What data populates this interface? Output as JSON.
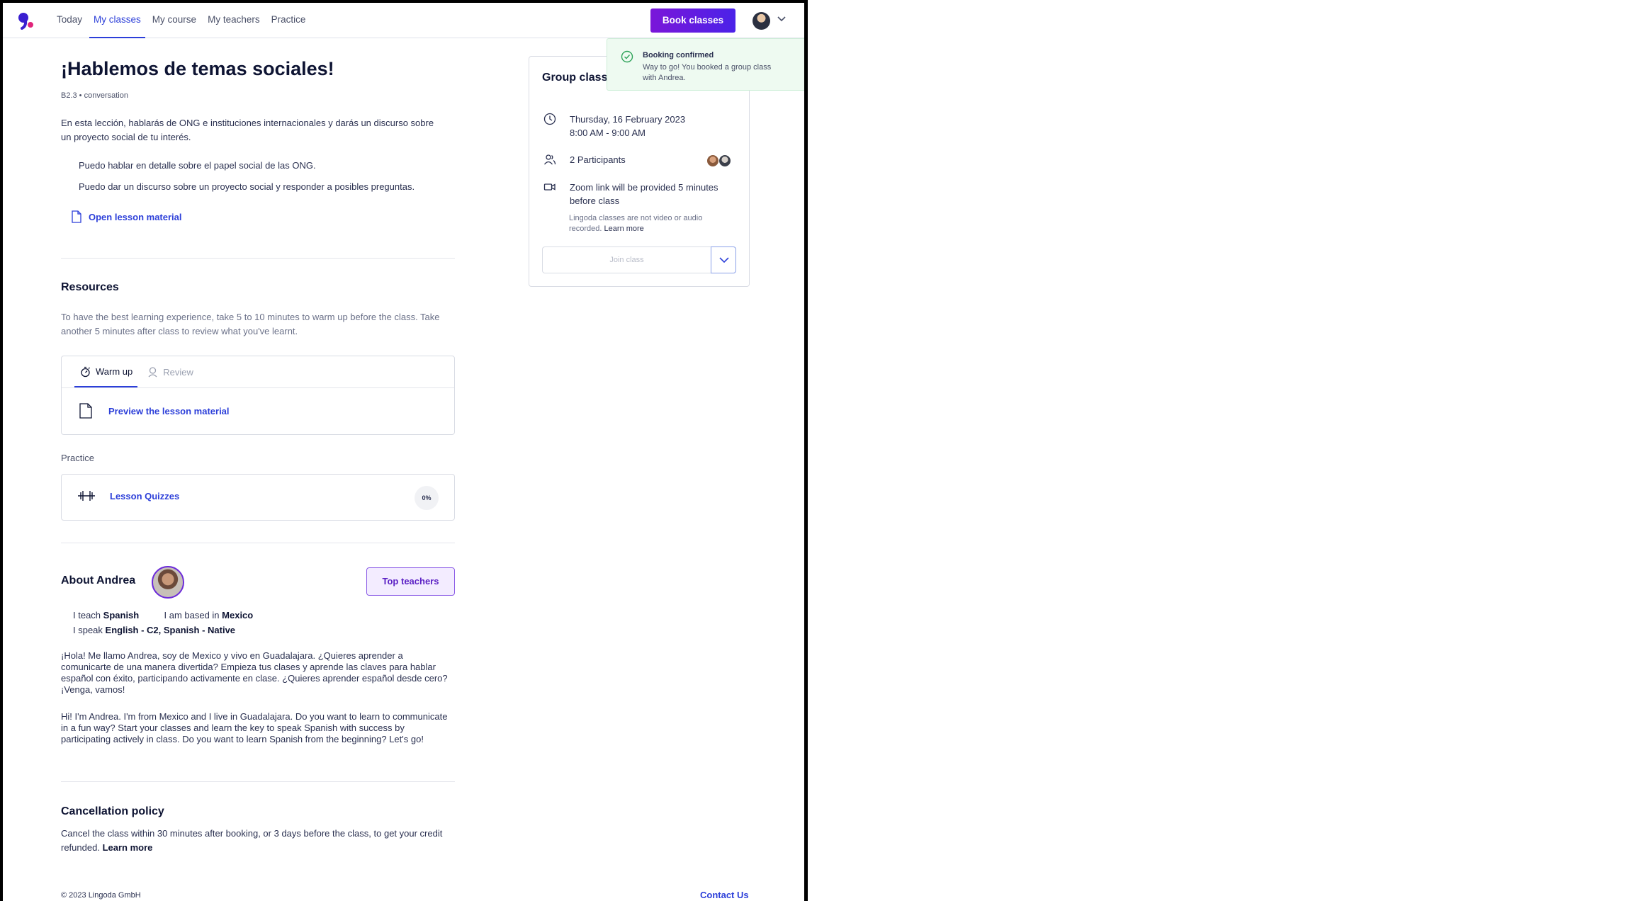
{
  "nav": {
    "items": [
      {
        "label": "Today",
        "active": false
      },
      {
        "label": "My classes",
        "active": true
      },
      {
        "label": "My course",
        "active": false
      },
      {
        "label": "My teachers",
        "active": false
      },
      {
        "label": "Practice",
        "active": false
      }
    ],
    "book_button": "Book classes"
  },
  "lesson": {
    "title": "¡Hablemos de temas sociales!",
    "level": "B2.3 • conversation",
    "description": "En esta lección, hablarás de ONG e instituciones internacionales y darás un discurso sobre un proyecto social de tu interés.",
    "goals": [
      "Puedo hablar en detalle sobre el papel social de las ONG.",
      "Puedo dar un discurso sobre un proyecto social y responder a posibles preguntas."
    ],
    "open_material": "Open lesson material"
  },
  "resources": {
    "heading": "Resources",
    "text": "To have the best learning experience, take 5 to 10 minutes to warm up before the class. Take another 5 minutes after class to review what you've learnt.",
    "tabs": [
      "Warm up",
      "Review"
    ],
    "preview_link": "Preview the lesson material"
  },
  "practice": {
    "label": "Practice",
    "quiz_link": "Lesson Quizzes",
    "progress": "0%"
  },
  "teacher": {
    "heading": "About Andrea",
    "top_button": "Top teachers",
    "teach_label": "I teach",
    "teach_value": "Spanish",
    "based_label": "I am based in",
    "based_value": "Mexico",
    "speak_label": "I speak",
    "speak_value": "English - C2, Spanish - Native",
    "bio_es": "¡Hola! Me llamo Andrea, soy de Mexico y vivo en Guadalajara. ¿Quieres aprender a comunicarte de una manera divertida? Empieza tus clases y aprende las claves para hablar español con éxito, participando activamente en clase. ¿Quieres aprender español desde cero? ¡Venga, vamos!",
    "bio_en": "Hi! I'm Andrea. I'm from Mexico and I live in Guadalajara. Do you want to learn to communicate in a fun way? Start your classes and learn the key to speak Spanish with success by participating actively in class. Do you want to learn Spanish from the beginning? Let's go!"
  },
  "cancellation": {
    "heading": "Cancellation policy",
    "text": "Cancel the class within 30 minutes after booking, or 3 days before the class, to get your credit refunded.",
    "link": "Learn more"
  },
  "group_class": {
    "title": "Group class",
    "date": "Thursday, 16 February 2023",
    "time": "8:00 AM - 9:00 AM",
    "participants": "2 Participants",
    "zoom": "Zoom link will be provided 5 minutes before class",
    "note": "Lingoda classes are not video or audio recorded.",
    "note_link": "Learn more",
    "join": "Join class"
  },
  "toast": {
    "title": "Booking confirmed",
    "message": "Way to go! You booked a group class with Andrea."
  },
  "footer": {
    "copyright": "© 2023 Lingoda GmbH",
    "contact": "Contact Us"
  },
  "colors": {
    "primary": "#2c3fd9",
    "accent_purple": "#6c2bd9",
    "success_bg": "#eefaf1"
  }
}
